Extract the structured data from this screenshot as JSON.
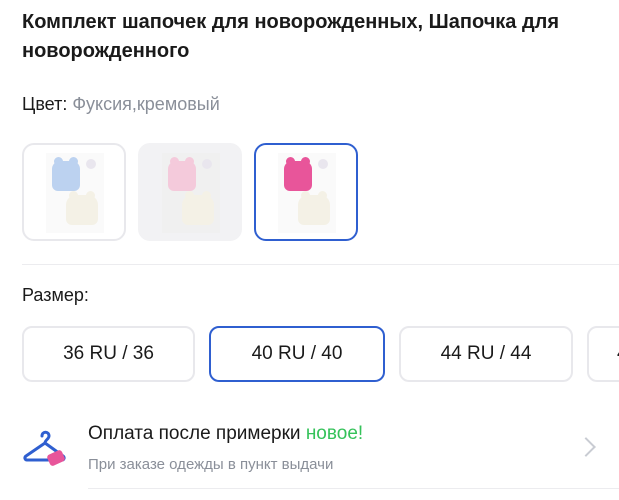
{
  "product": {
    "title": "Комплект шапочек для новорожденных, Шапочка для новорожденного"
  },
  "color": {
    "label": "Цвет:",
    "value": "Фуксия,кремовый",
    "options": [
      {
        "name": "blue-cream",
        "hat_color": "#bcd2f0",
        "selected": false
      },
      {
        "name": "pink-cream",
        "hat_color": "#f4cadb",
        "selected": false
      },
      {
        "name": "fuchsia-cream",
        "hat_color": "#e8559a",
        "selected": true
      }
    ]
  },
  "size": {
    "label": "Размер:",
    "options": [
      {
        "label": "36 RU / 36",
        "selected": false
      },
      {
        "label": "40 RU / 40",
        "selected": true
      },
      {
        "label": "44 RU / 44",
        "selected": false
      },
      {
        "label": "4",
        "selected": false
      }
    ]
  },
  "promo": {
    "title": "Оплата после примерки",
    "badge": "новое!",
    "subtitle": "При заказе одежды в пункт выдачи",
    "icon": "hanger-icon"
  },
  "colors": {
    "accent": "#2f5fd0",
    "new_badge": "#35c25a",
    "muted_text": "#8a8f99"
  }
}
